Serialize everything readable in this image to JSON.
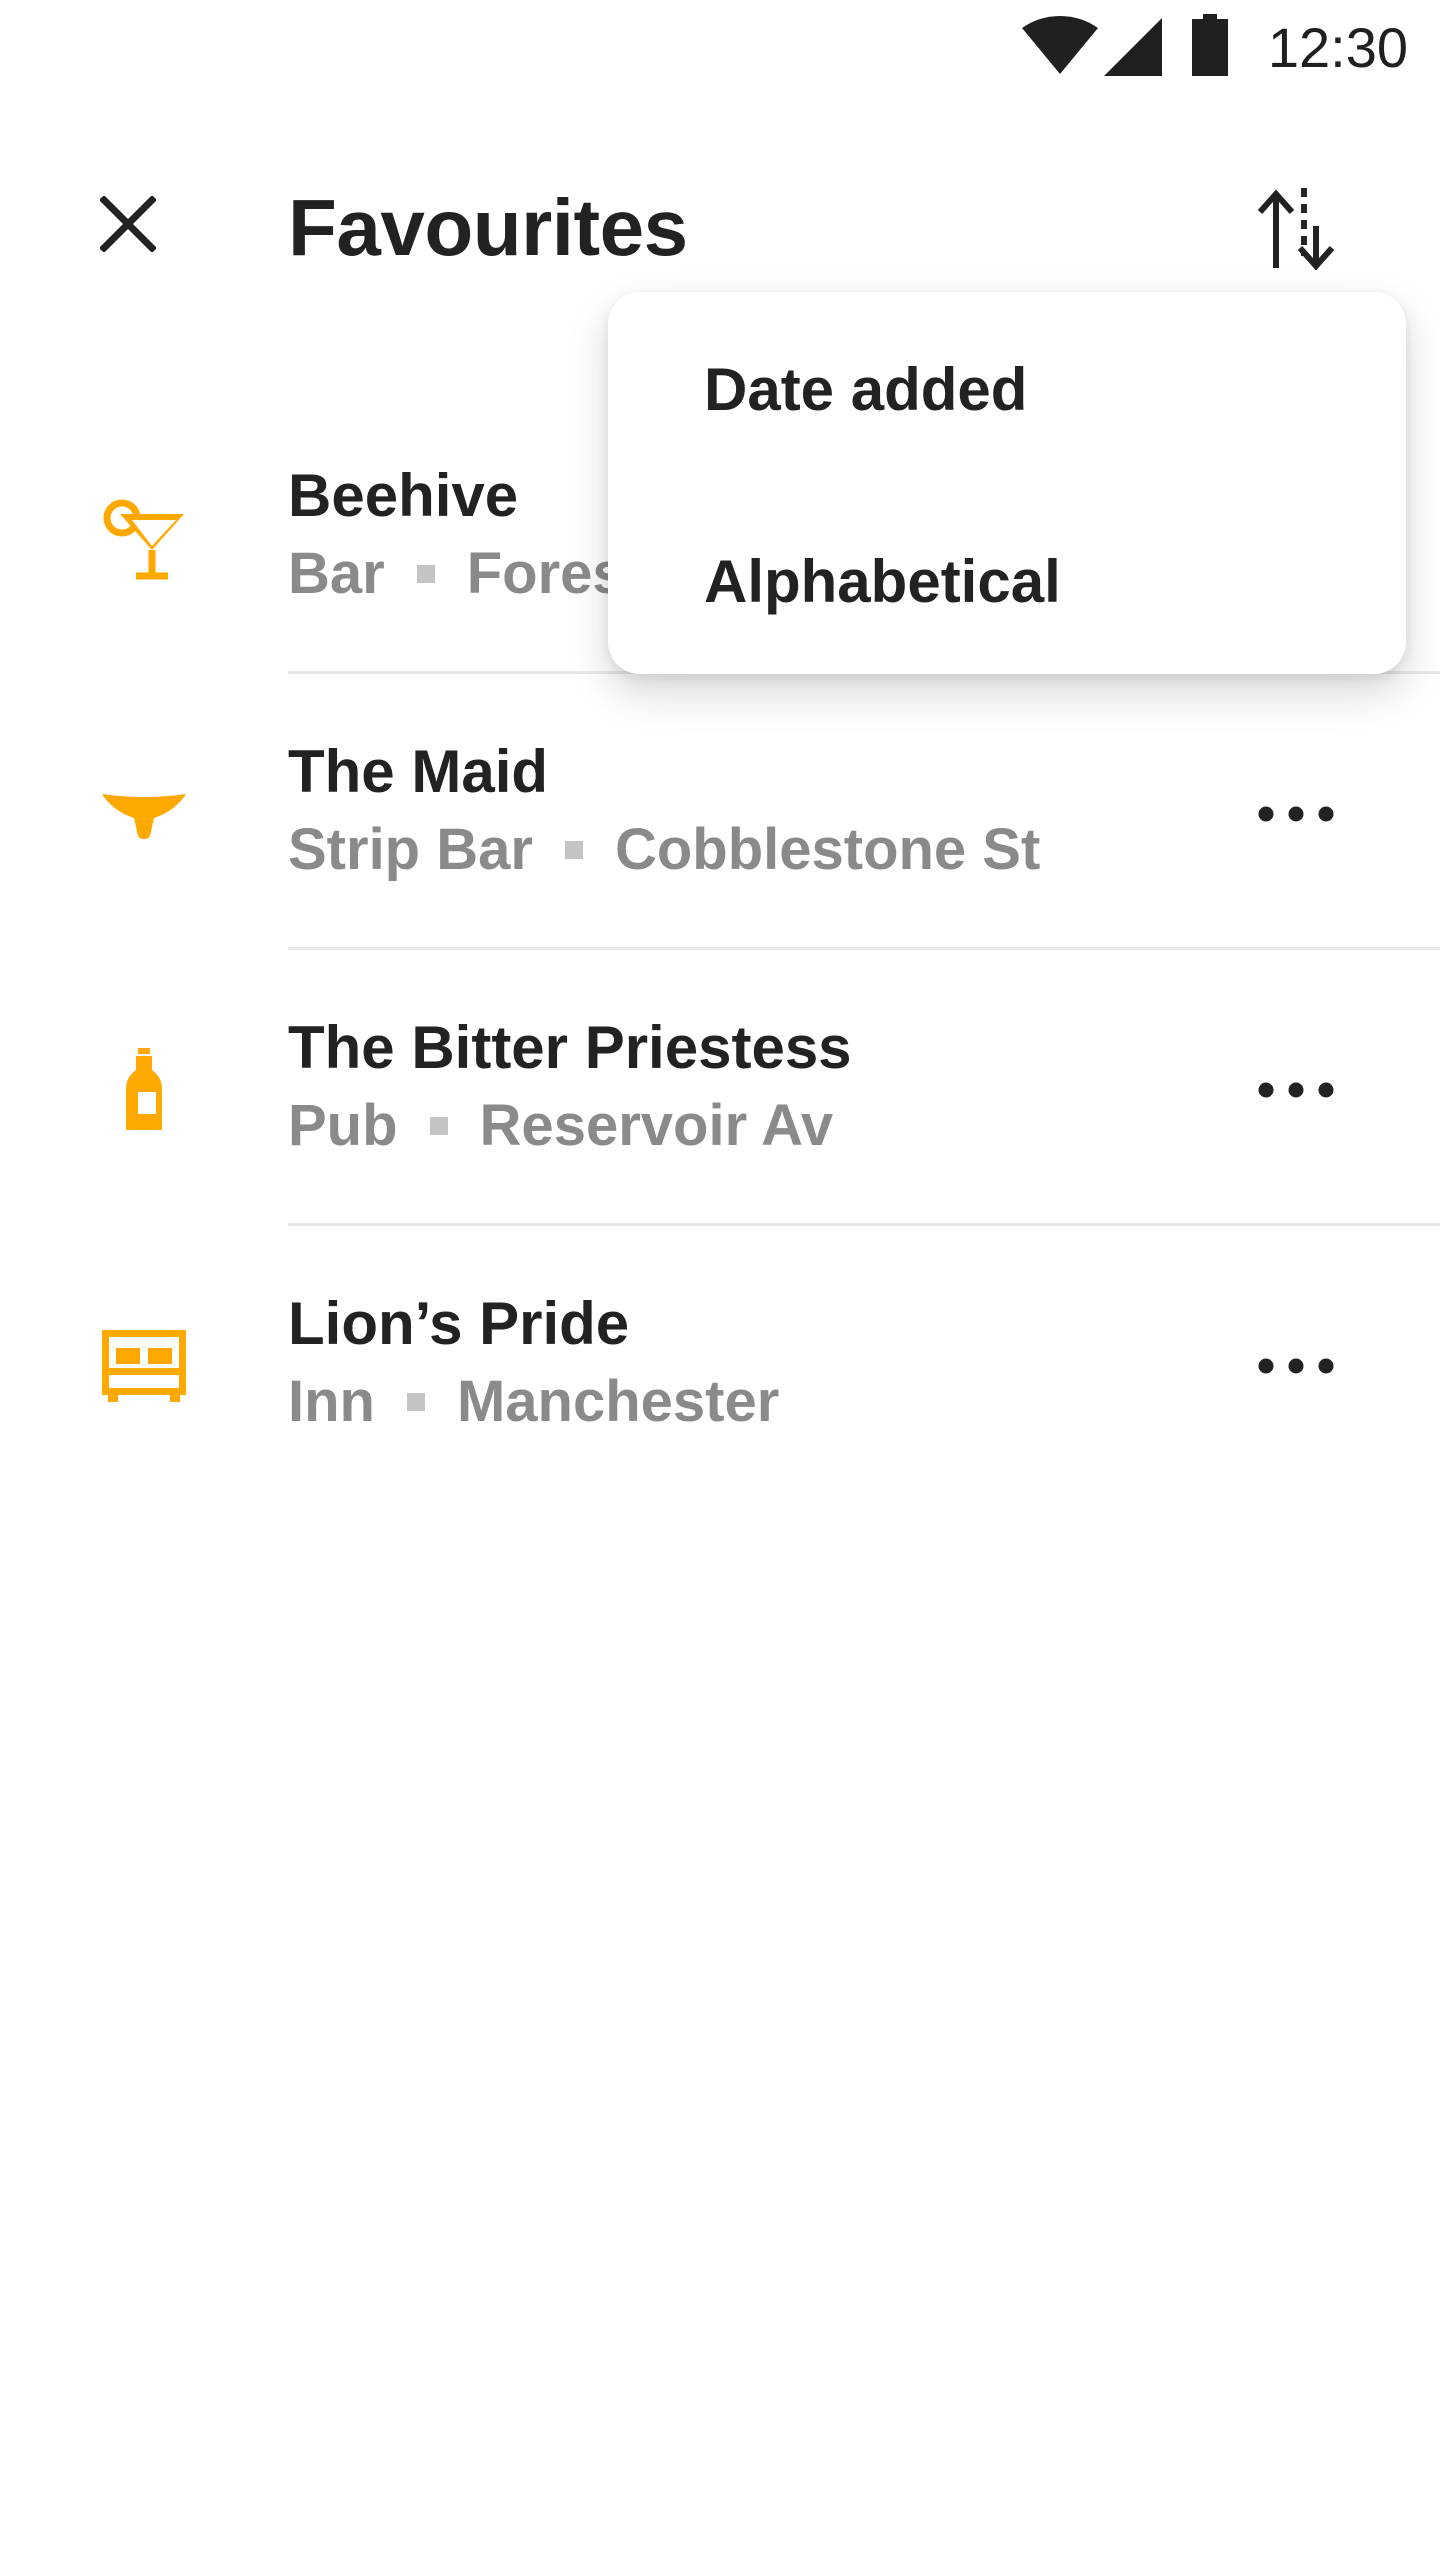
{
  "status_bar": {
    "time": "12:30",
    "icons": [
      "wifi-icon",
      "cellular-signal-icon",
      "battery-icon"
    ]
  },
  "app_bar": {
    "close_icon": "close-icon",
    "title": "Favourites",
    "sort_icon": "sort-icon"
  },
  "sort_menu": {
    "options": [
      {
        "label": "Date added"
      },
      {
        "label": "Alphabetical"
      }
    ]
  },
  "favourites": [
    {
      "name": "Beehive",
      "type": "Bar",
      "location": "Fores",
      "icon": "cocktail-icon"
    },
    {
      "name": "The Maid",
      "type": "Strip Bar",
      "location": "Cobblestone St",
      "icon": "underwear-icon"
    },
    {
      "name": "The Bitter Priestess",
      "type": "Pub",
      "location": "Reservoir Av",
      "icon": "beer-bottle-icon"
    },
    {
      "name": "Lion’s Pride",
      "type": "Inn",
      "location": "Manchester",
      "icon": "bed-icon"
    }
  ],
  "more_icon": "more-horizontal-icon",
  "colors": {
    "accent": "#FFA800",
    "text_primary": "#222222",
    "text_secondary": "#8A8A8A",
    "divider": "#E8E8E8"
  }
}
